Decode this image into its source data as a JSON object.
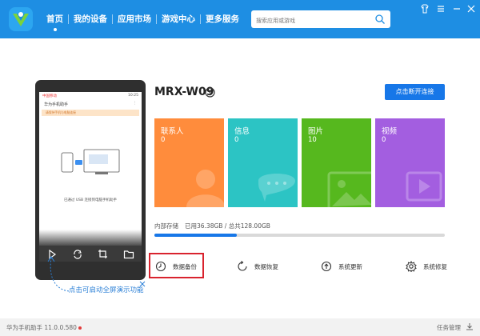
{
  "nav": {
    "items": [
      {
        "label": "首页",
        "active": true
      },
      {
        "label": "我的设备"
      },
      {
        "label": "应用市场"
      },
      {
        "label": "游戏中心"
      },
      {
        "label": "更多服务"
      }
    ]
  },
  "search": {
    "placeholder": "搜索应用或游戏"
  },
  "phone_screen": {
    "status_left": "中国移动",
    "status_right": "10:25",
    "title": "华为手机助手",
    "banner": "请保持手机与电脑连接",
    "caption": "已通过 USB 连接到电脑手机助手"
  },
  "hint": {
    "text": "点击可启动全屏演示功能"
  },
  "device": {
    "name": "MRX-W09",
    "reconnect_label": "点击断开连接"
  },
  "tiles": [
    {
      "name": "联系人",
      "count": "0",
      "color": "#ff8c3c"
    },
    {
      "name": "信息",
      "count": "0",
      "color": "#2cc4c4"
    },
    {
      "name": "图片",
      "count": "10",
      "color": "#56b81e"
    },
    {
      "name": "视频",
      "count": "0",
      "color": "#a35ee0"
    }
  ],
  "storage": {
    "label": "内部存储",
    "value": "已用36.38GB / 总共128.00GB",
    "used_fraction": 0.284
  },
  "actions": [
    {
      "label": "数据备份",
      "icon": "backup-icon"
    },
    {
      "label": "数据恢复",
      "icon": "restore-icon"
    },
    {
      "label": "系统更新",
      "icon": "update-icon"
    },
    {
      "label": "系统修复",
      "icon": "repair-icon"
    }
  ],
  "statusbar": {
    "version": "华为手机助手 11.0.0.580",
    "task_manager": "任务管理"
  },
  "colors": {
    "topbar": "#1e8ee3",
    "accent": "#1777e8",
    "highlight": "#d9232e"
  }
}
